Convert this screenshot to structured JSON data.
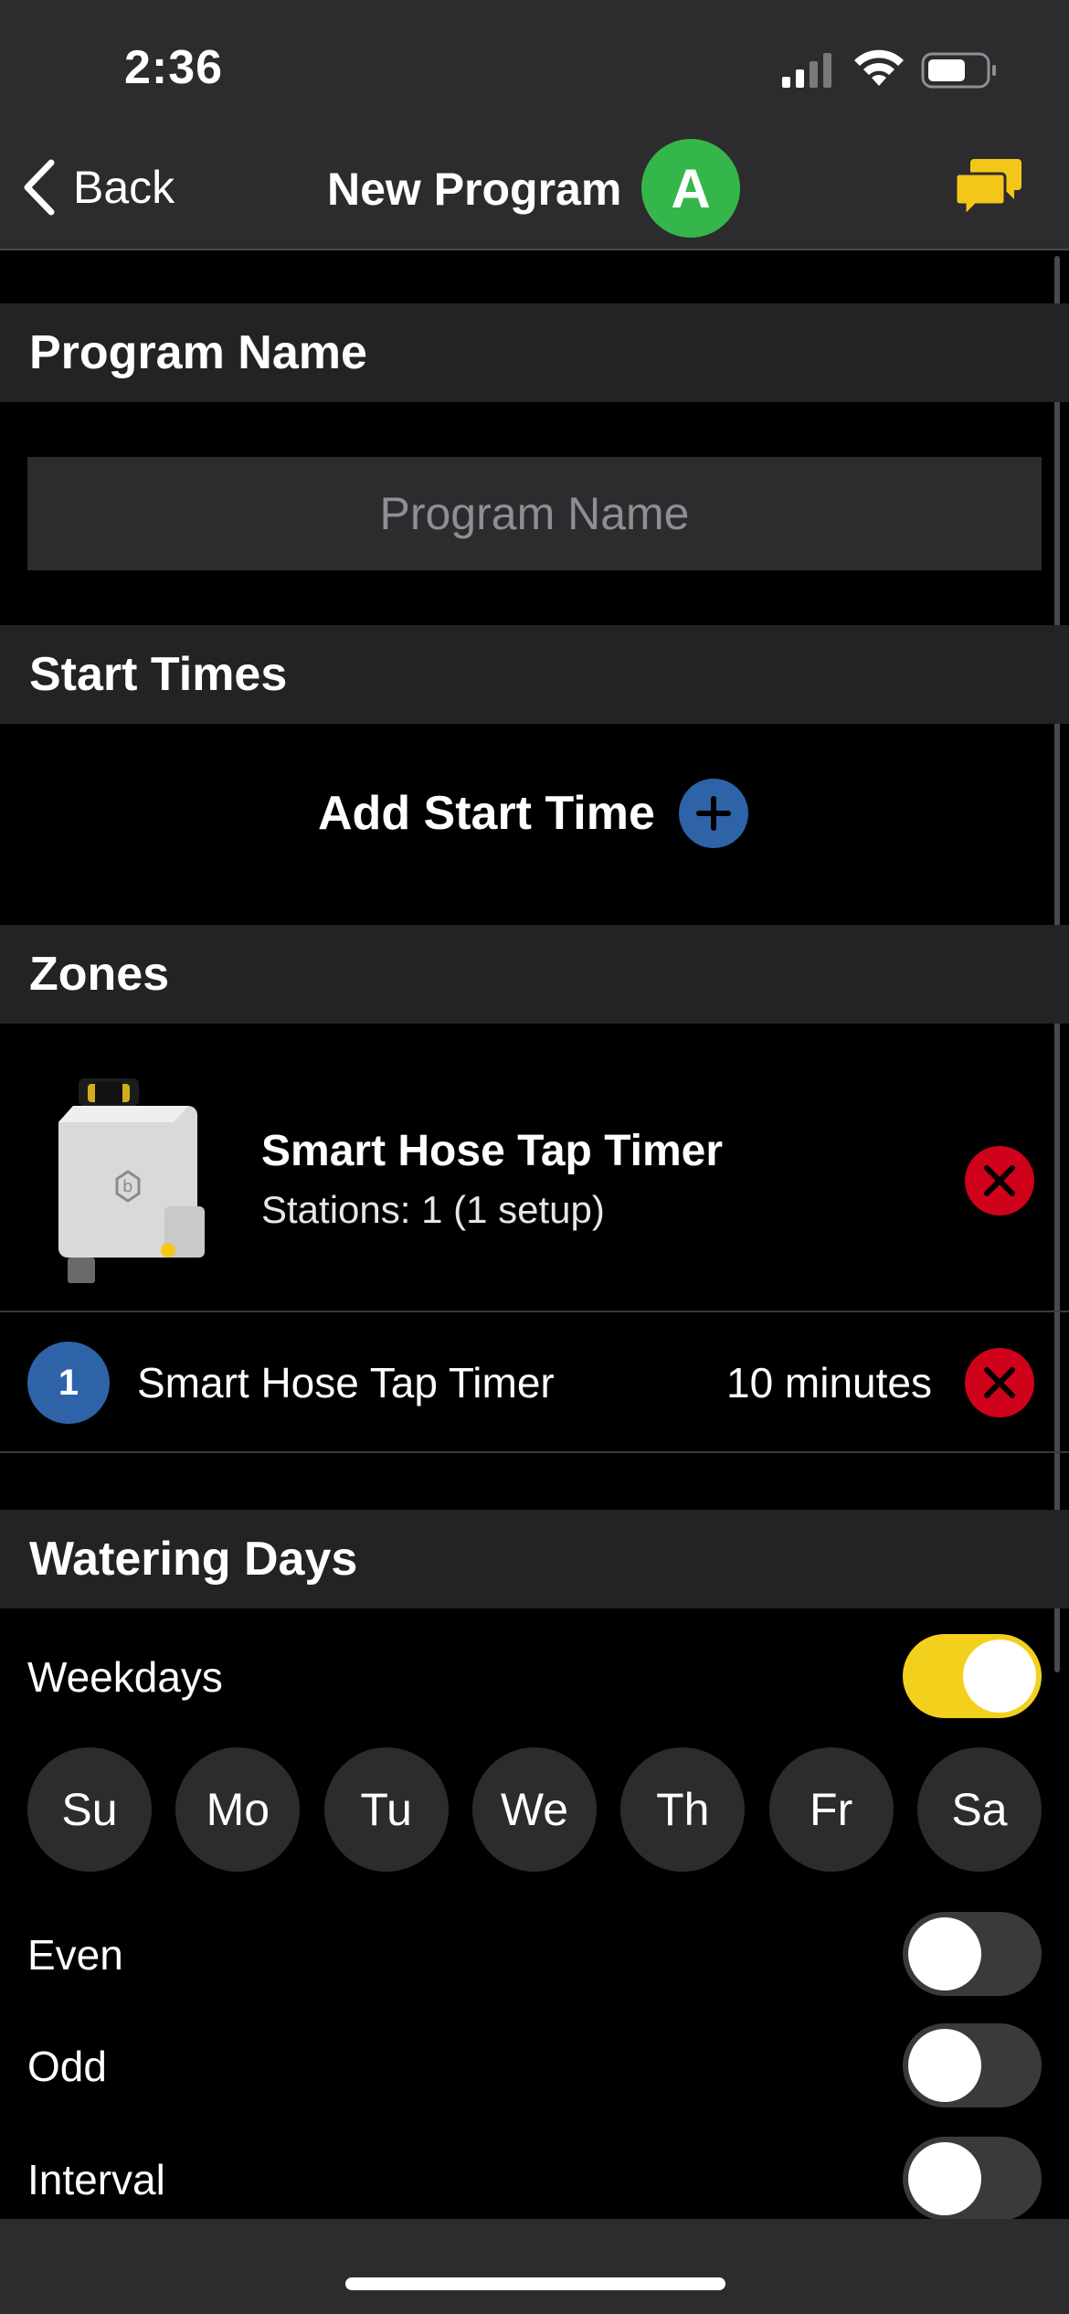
{
  "status_bar": {
    "time": "2:36"
  },
  "nav": {
    "back_label": "Back",
    "title": "New Program",
    "avatar_letter": "A",
    "avatar_color": "#35b64b",
    "chat_icon_color": "#f3c719"
  },
  "program_name": {
    "header": "Program Name",
    "input_value": "",
    "input_placeholder": "Program Name"
  },
  "start_times": {
    "header": "Start Times",
    "add_label": "Add Start Time"
  },
  "zones": {
    "header": "Zones",
    "device": {
      "title": "Smart Hose Tap Timer",
      "subtitle": "Stations: 1 (1 setup)"
    },
    "stations": [
      {
        "number": "1",
        "name": "Smart Hose Tap Timer",
        "duration": "10 minutes"
      }
    ]
  },
  "watering_days": {
    "header": "Watering Days",
    "weekdays": {
      "label": "Weekdays",
      "on": true
    },
    "days": [
      "Su",
      "Mo",
      "Tu",
      "We",
      "Th",
      "Fr",
      "Sa"
    ],
    "even": {
      "label": "Even",
      "on": false
    },
    "odd": {
      "label": "Odd",
      "on": false
    },
    "interval": {
      "label": "Interval",
      "on": false
    }
  },
  "colors": {
    "accent_yellow": "#f3d01c",
    "accent_blue": "#2e63a8",
    "danger_red": "#d0021b"
  }
}
